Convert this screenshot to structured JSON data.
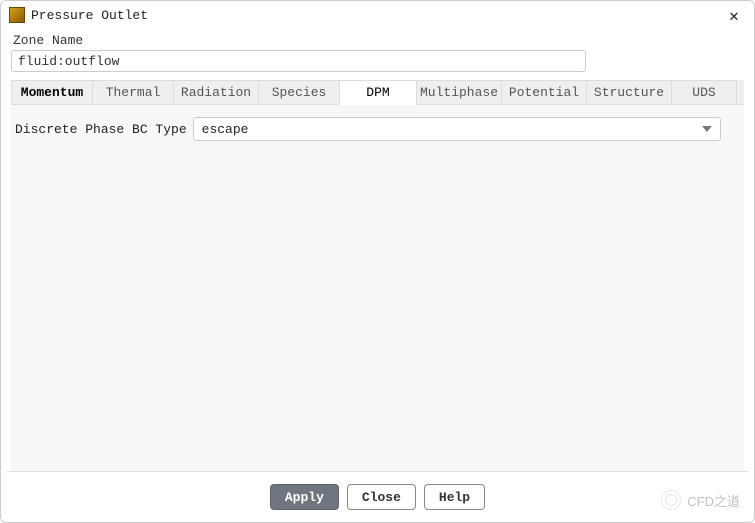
{
  "window": {
    "title": "Pressure Outlet"
  },
  "zone": {
    "label": "Zone Name",
    "value": "fluid:outflow"
  },
  "tabs": [
    {
      "label": "Momentum"
    },
    {
      "label": "Thermal"
    },
    {
      "label": "Radiation"
    },
    {
      "label": "Species"
    },
    {
      "label": "DPM"
    },
    {
      "label": "Multiphase"
    },
    {
      "label": "Potential"
    },
    {
      "label": "Structure"
    },
    {
      "label": "UDS"
    }
  ],
  "dpm": {
    "bc_type_label": "Discrete Phase BC Type",
    "bc_type_value": "escape"
  },
  "buttons": {
    "apply": "Apply",
    "close": "Close",
    "help": "Help"
  },
  "watermark": {
    "text": "CFD之道"
  }
}
